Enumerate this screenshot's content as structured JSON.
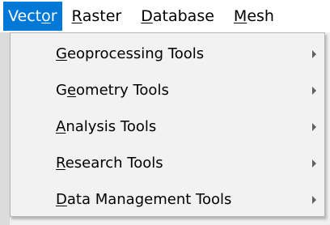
{
  "menubar": {
    "items": [
      {
        "prefix": "Vect",
        "mnemonic": "o",
        "suffix": "r",
        "active": true
      },
      {
        "prefix": "",
        "mnemonic": "R",
        "suffix": "aster",
        "active": false
      },
      {
        "prefix": "",
        "mnemonic": "D",
        "suffix": "atabase",
        "active": false
      },
      {
        "prefix": "",
        "mnemonic": "M",
        "suffix": "esh",
        "active": false
      }
    ]
  },
  "dropdown": {
    "items": [
      {
        "mnemonic": "G",
        "suffix": "eoprocessing Tools",
        "icon": "chevron-right-icon"
      },
      {
        "prefix": "G",
        "mnemonic": "e",
        "suffix": "ometry Tools",
        "icon": "chevron-right-icon"
      },
      {
        "mnemonic": "A",
        "suffix": "nalysis Tools",
        "icon": "chevron-right-icon"
      },
      {
        "mnemonic": "R",
        "suffix": "esearch Tools",
        "icon": "chevron-right-icon"
      },
      {
        "mnemonic": "D",
        "suffix": "ata Management Tools",
        "icon": "chevron-right-icon"
      }
    ]
  },
  "colors": {
    "active_menu_bg": "#0078d7",
    "active_menu_text": "#ffffff",
    "dropdown_bg": "#f2f2f2"
  }
}
